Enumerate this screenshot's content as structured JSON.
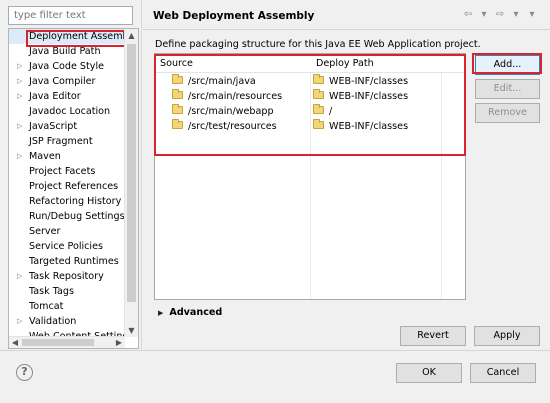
{
  "sidebar": {
    "filter_placeholder": "type filter text",
    "items": [
      {
        "label": "Deployment Assembl",
        "has_children": false,
        "selected": true
      },
      {
        "label": "Java Build Path",
        "has_children": false
      },
      {
        "label": "Java Code Style",
        "has_children": true
      },
      {
        "label": "Java Compiler",
        "has_children": true
      },
      {
        "label": "Java Editor",
        "has_children": true
      },
      {
        "label": "Javadoc Location",
        "has_children": false
      },
      {
        "label": "JavaScript",
        "has_children": true
      },
      {
        "label": "JSP Fragment",
        "has_children": false
      },
      {
        "label": "Maven",
        "has_children": true
      },
      {
        "label": "Project Facets",
        "has_children": false
      },
      {
        "label": "Project References",
        "has_children": false
      },
      {
        "label": "Refactoring History",
        "has_children": false
      },
      {
        "label": "Run/Debug Settings",
        "has_children": false
      },
      {
        "label": "Server",
        "has_children": false
      },
      {
        "label": "Service Policies",
        "has_children": false
      },
      {
        "label": "Targeted Runtimes",
        "has_children": false
      },
      {
        "label": "Task Repository",
        "has_children": true
      },
      {
        "label": "Task Tags",
        "has_children": false
      },
      {
        "label": "Tomcat",
        "has_children": false
      },
      {
        "label": "Validation",
        "has_children": true
      },
      {
        "label": "Web Content Settings",
        "has_children": false
      }
    ]
  },
  "header": {
    "title": "Web Deployment Assembly"
  },
  "main": {
    "description": "Define packaging structure for this Java EE Web Application project.",
    "columns": [
      "Source",
      "Deploy Path"
    ],
    "rows": [
      {
        "source": "/src/main/java",
        "deploy_path": "WEB-INF/classes"
      },
      {
        "source": "/src/main/resources",
        "deploy_path": "WEB-INF/classes"
      },
      {
        "source": "/src/main/webapp",
        "deploy_path": "/"
      },
      {
        "source": "/src/test/resources",
        "deploy_path": "WEB-INF/classes"
      }
    ],
    "buttons": {
      "add": "Add...",
      "edit": "Edit...",
      "remove": "Remove"
    },
    "advanced_label": "Advanced",
    "revert": "Revert",
    "apply": "Apply"
  },
  "footer": {
    "ok": "OK",
    "cancel": "Cancel"
  },
  "colors": {
    "highlight_red": "#d9232e",
    "folder_yellow": "#f2d67b"
  }
}
